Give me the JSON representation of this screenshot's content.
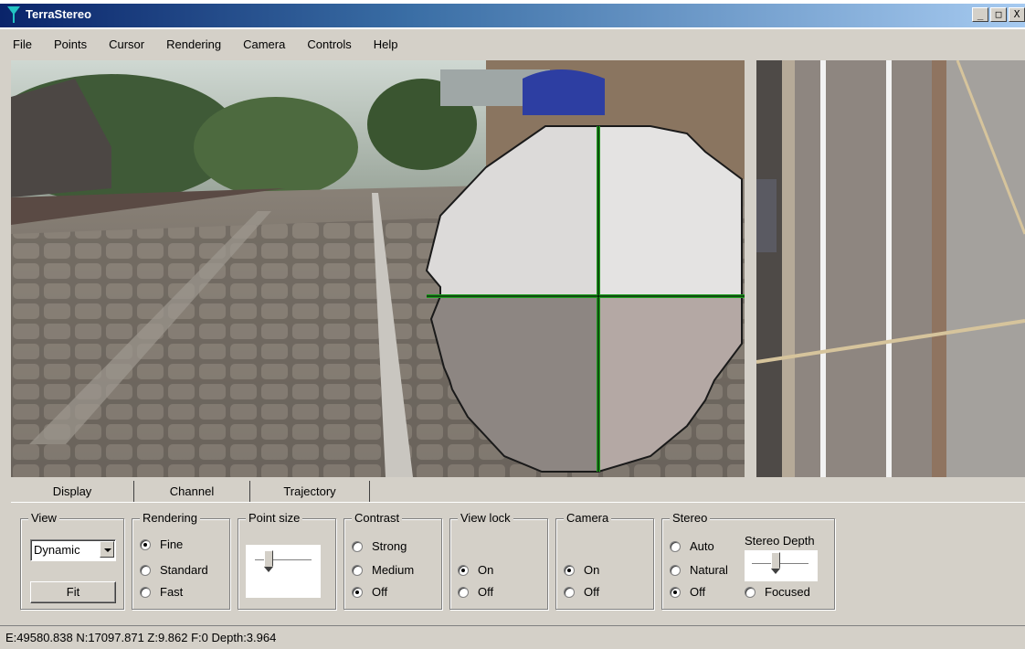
{
  "window": {
    "title": "TerraStereo",
    "buttons": [
      "_",
      "□",
      "X"
    ]
  },
  "menu": [
    "File",
    "Points",
    "Cursor",
    "Rendering",
    "Camera",
    "Controls",
    "Help"
  ],
  "tabs": [
    {
      "label": "Display",
      "active": true
    },
    {
      "label": "Channel",
      "active": false
    },
    {
      "label": "Trajectory",
      "active": false
    }
  ],
  "panel": {
    "view": {
      "title": "View",
      "select_value": "Dynamic",
      "fit_label": "Fit"
    },
    "rendering": {
      "title": "Rendering",
      "options": [
        "Fine",
        "Standard",
        "Fast"
      ],
      "selected": "Fine"
    },
    "point_size": {
      "title": "Point size",
      "level": 0.2
    },
    "contrast": {
      "title": "Contrast",
      "options": [
        "Strong",
        "Medium",
        "Off"
      ],
      "selected": "Off"
    },
    "view_lock": {
      "title": "View lock",
      "options": [
        "On",
        "Off"
      ],
      "selected": "On"
    },
    "camera": {
      "title": "Camera",
      "options": [
        "On",
        "Off"
      ],
      "selected": "On"
    },
    "stereo": {
      "title": "Stereo",
      "options": [
        "Auto",
        "Natural",
        "Off"
      ],
      "selected": "Off",
      "depth_title": "Stereo Depth",
      "depth_level": 0.4,
      "focused_label": "Focused",
      "focused_checked": false
    }
  },
  "status": {
    "text": "E:49580.838 N:17097.871 Z:9.862  F:0 Depth:3.964"
  },
  "colors": {
    "cursor_green": "#1f9d1f",
    "title_bar_start": "#0a246a",
    "title_bar_end": "#a6caf0"
  },
  "icons": {
    "app_logo": "terrastereo-logo-icon"
  }
}
